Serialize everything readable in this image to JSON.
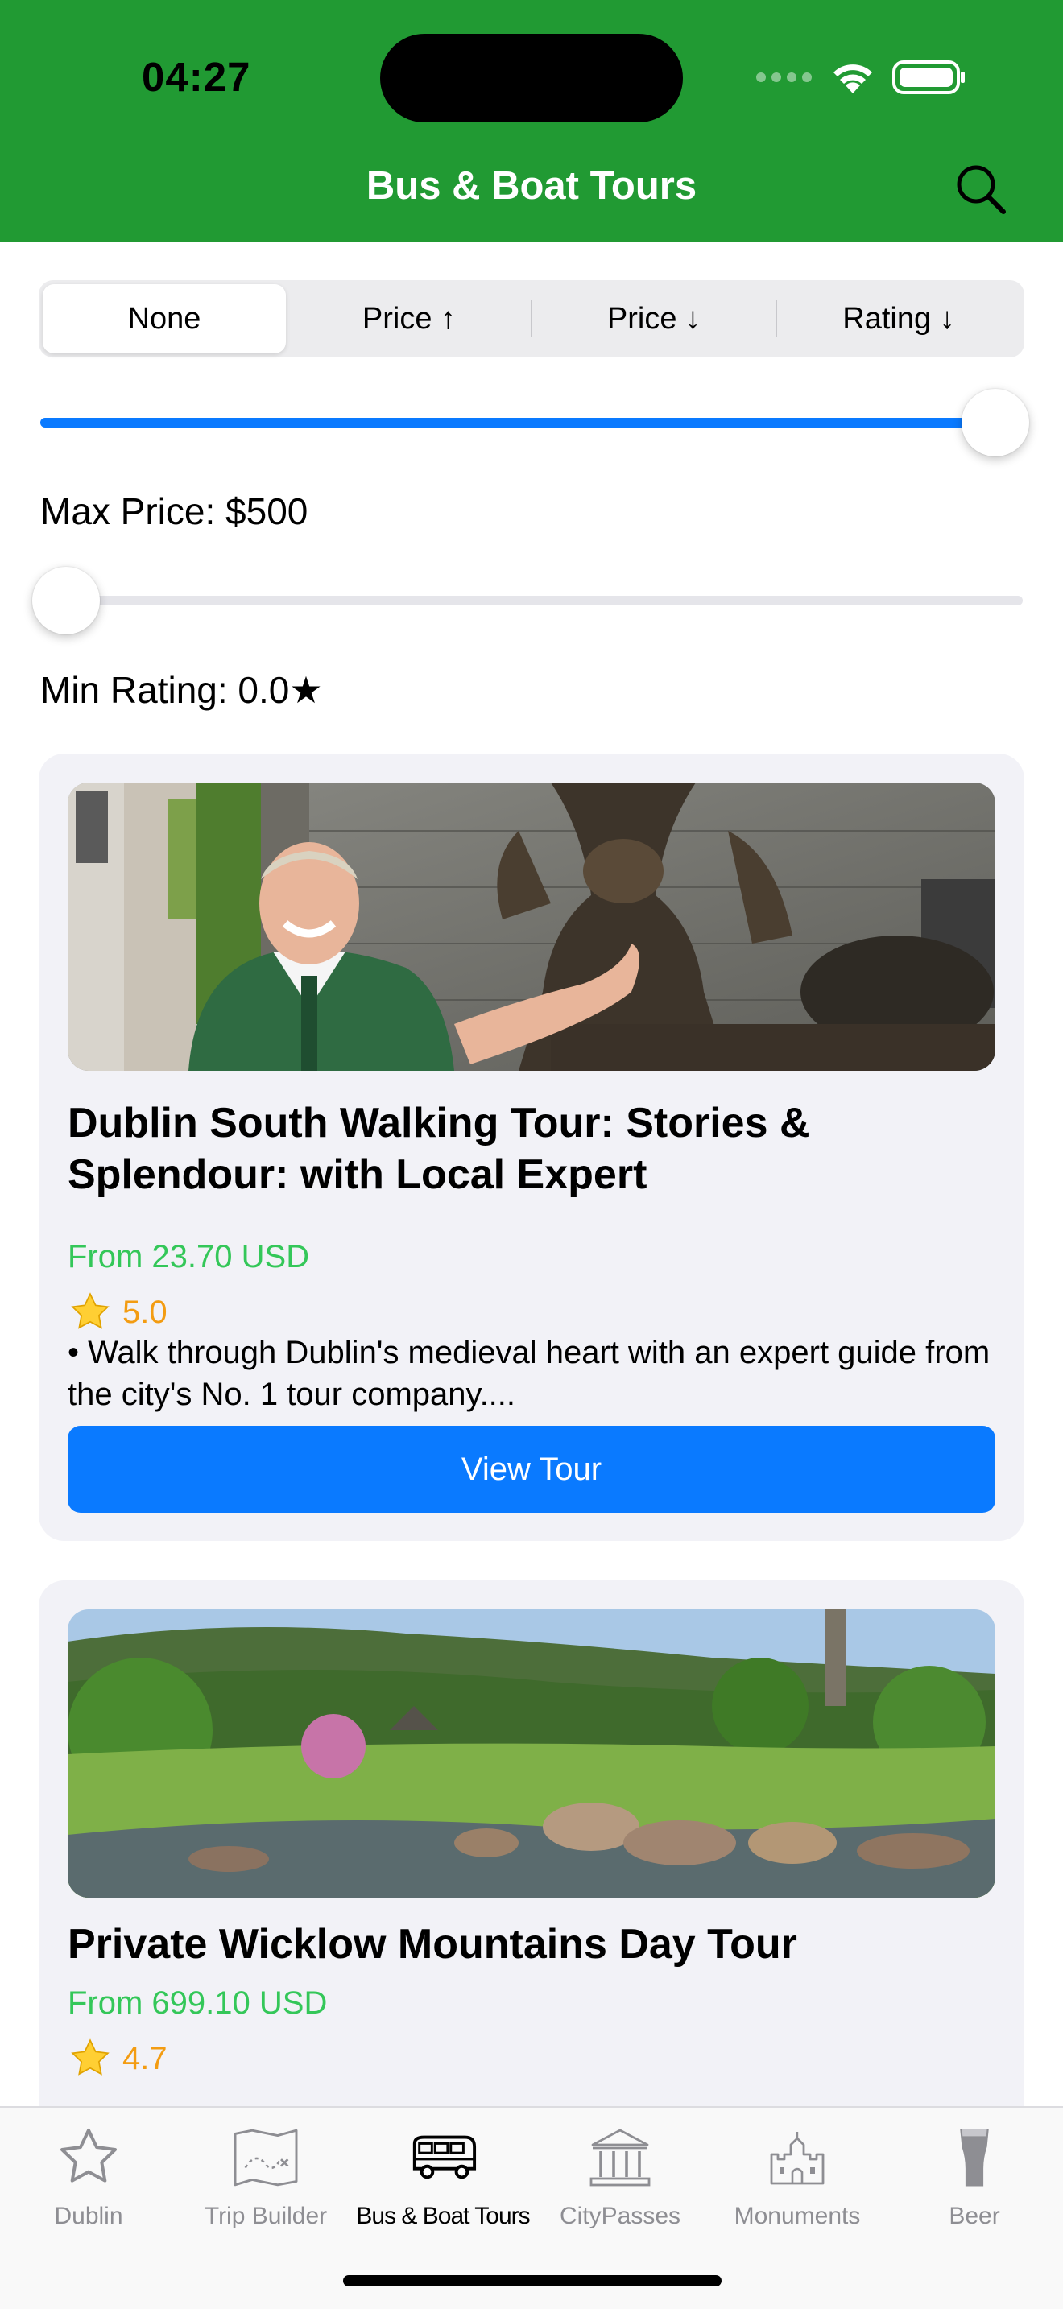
{
  "status_bar": {
    "time": "04:27"
  },
  "nav": {
    "title": "Bus & Boat Tours"
  },
  "sort_options": [
    {
      "label": "None",
      "selected": true
    },
    {
      "label": "Price ↑",
      "selected": false
    },
    {
      "label": "Price ↓",
      "selected": false
    },
    {
      "label": "Rating ↓",
      "selected": false
    }
  ],
  "filters": {
    "max_price_label": "Max Price: $500",
    "max_price_fraction": 1.0,
    "min_rating_label": "Min Rating: 0.0★",
    "min_rating_fraction": 0.0
  },
  "tours": [
    {
      "title": "Dublin South Walking Tour: Stories & Splendour: with Local Expert",
      "price": "From 23.70 USD",
      "rating": "5.0",
      "description": "• Walk through Dublin's medieval heart with an expert guide from the city's No. 1 tour company....",
      "button": "View Tour"
    },
    {
      "title": "Private Wicklow Mountains Day Tour",
      "price": "From 699.10 USD",
      "rating": "4.7"
    }
  ],
  "tabbar": {
    "items": [
      {
        "label": "Dublin",
        "icon": "star-icon",
        "active": false
      },
      {
        "label": "Trip Builder",
        "icon": "map-icon",
        "active": false
      },
      {
        "label": "Bus & Boat Tours",
        "icon": "bus-icon",
        "active": true
      },
      {
        "label": "CityPasses",
        "icon": "building-icon",
        "active": false
      },
      {
        "label": "Monuments",
        "icon": "castle-icon",
        "active": false
      },
      {
        "label": "Beer",
        "icon": "beer-icon",
        "active": false
      }
    ]
  },
  "colors": {
    "header": "#219a33",
    "accent": "#0a7aff",
    "price": "#34c759",
    "rating": "#f39c12"
  }
}
